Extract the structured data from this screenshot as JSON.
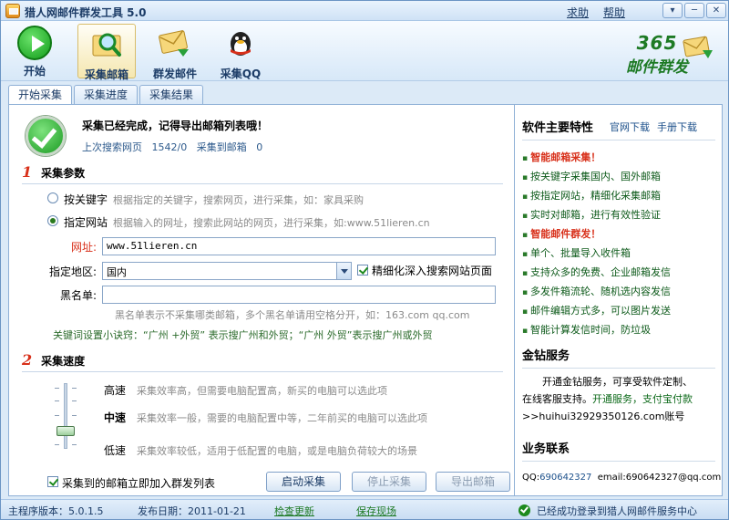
{
  "window": {
    "title": "猎人网邮件群发工具 5.0",
    "help_link": "求助",
    "help2_link": "帮助",
    "min_glyph": "▾",
    "minimize_glyph": "─",
    "close_glyph": "✕"
  },
  "toolbar": {
    "items": [
      {
        "label": "开始",
        "icon": "play-icon"
      },
      {
        "label": "采集邮箱",
        "icon": "magnifier-icon"
      },
      {
        "label": "群发邮件",
        "icon": "envelope-icon"
      },
      {
        "label": "采集QQ",
        "icon": "qq-penguin-icon"
      }
    ],
    "brand_num": "365",
    "brand_name": "邮件群发"
  },
  "tabs": [
    "开始采集",
    "采集进度",
    "采集结果"
  ],
  "status_card": {
    "title": "采集已经完成，记得导出邮箱列表哦！",
    "info_prefix": "上次搜索网页",
    "pages": "1542/0",
    "info_mid": "采集到邮箱",
    "emails": "0"
  },
  "params": {
    "section_num": "1",
    "section_title": "采集参数",
    "opt_keyword": "按关键字",
    "opt_keyword_hint": "根据指定的关键字，搜索网页，进行采集，如：家具采购",
    "opt_site": "指定网站",
    "opt_site_hint": "根据输入的网址，搜索此网站的网页，进行采集，如:www.51lieren.cn",
    "url_label": "网址:",
    "url_value": "www.51lieren.cn",
    "region_label": "指定地区:",
    "region_value": "国内",
    "deep_search_label": "精细化深入搜索网站页面",
    "blacklist_label": "黑名单:",
    "blacklist_value": "",
    "blacklist_hint": "黑名单表示不采集哪类邮箱，多个黑名单请用空格分开，如：163.com qq.com",
    "keyword_tip": "关键词设置小诀窍：“广州 +外贸” 表示搜广州和外贸；“广州 外贸”表示搜广州或外贸"
  },
  "speed": {
    "section_num": "2",
    "section_title": "采集速度",
    "level": "中速",
    "high": "高速",
    "high_desc": "采集效率高，但需要电脑配置高，新买的电脑可以选此项",
    "mid": "中速",
    "mid_desc": "采集效率一般，需要的电脑配置中等，二年前买的电脑可以选此项",
    "low": "低速",
    "low_desc": "采集效率较低，适用于低配置的电脑，或是电脑负荷较大的场景"
  },
  "actions": {
    "add_to_list_label": "采集到的邮箱立即加入群发列表",
    "start": "启动采集",
    "stop": "停止采集",
    "export": "导出邮箱"
  },
  "sidebar": {
    "features_title": "软件主要特性",
    "link_download": "官网下载",
    "link_manual": "手册下载",
    "features": [
      {
        "text": "智能邮箱采集！",
        "highlight": true
      },
      {
        "text": "按关键字采集国内、国外邮箱",
        "highlight": false
      },
      {
        "text": "按指定网站，精细化采集邮箱",
        "highlight": false
      },
      {
        "text": "实时对邮箱，进行有效性验证",
        "highlight": false
      },
      {
        "text": "智能邮件群发！",
        "highlight": true
      },
      {
        "text": "单个、批量导入收件箱",
        "highlight": false
      },
      {
        "text": "支持众多的免费、企业邮箱发信",
        "highlight": false
      },
      {
        "text": "多发件箱流轮、随机选内容发信",
        "highlight": false
      },
      {
        "text": "邮件编辑方式多，可以图片发送",
        "highlight": false
      },
      {
        "text": "智能计算发信时间，防垃圾",
        "highlight": false
      }
    ],
    "service_title": "金钻服务",
    "service_line1": "开通金钻服务，可享受软件定制、",
    "service_line2a": "在线客服支持。",
    "service_line2b": "开通服务，支付宝付款",
    "service_line3": ">>huihui32929350126.com账号",
    "contact_title": "业务联系",
    "contact_qq_label": "QQ:",
    "contact_qq": "690642327",
    "contact_email_label": "email:",
    "contact_email": "690642327@qq.com"
  },
  "statusbar": {
    "version_label": "主程序版本：",
    "version": "5.0.1.5",
    "date_label": "发布日期：",
    "date": "2011-01-21",
    "check_update": "检查更新",
    "save_site": "保存现场",
    "login_status": "已经成功登录到猎人网邮件服务中心"
  },
  "colors": {
    "accent_green": "#1d7a24",
    "alert_red": "#d8301a",
    "link_blue": "#1b4f8a"
  }
}
